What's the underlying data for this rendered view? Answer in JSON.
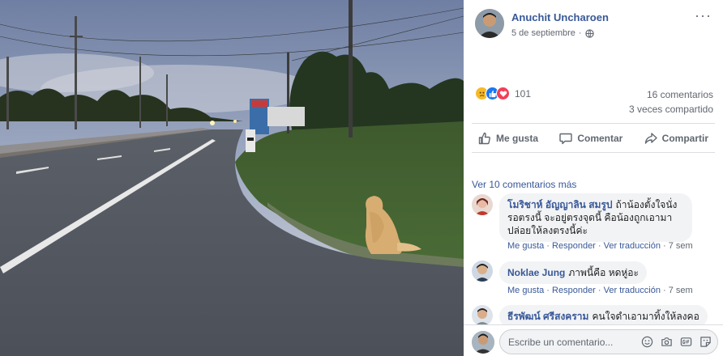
{
  "post": {
    "author": "Anuchit Uncharoen",
    "date": "5 de septiembre",
    "privacy_icon": "globe-icon",
    "more_icon": "more-options-icon",
    "more_label": "···"
  },
  "stats": {
    "reaction_icons": [
      "sad-reaction-icon",
      "like-reaction-icon",
      "love-reaction-icon"
    ],
    "reaction_count": "101",
    "comments": "16 comentarios",
    "shares": "3 veces compartido"
  },
  "actions": {
    "like": "Me gusta",
    "comment": "Comentar",
    "share": "Compartir"
  },
  "comments": {
    "more_link": "Ver 10 comentarios más",
    "items": [
      {
        "name": "โมริชาห์ อัญญาลิน สมรูป",
        "text": "ถ้าน้องตั้งใจนั่งรอตรงนี้ จะอยู่ตรงจุดนี้ คือน้องถูกเอามาปล่อยให้ลงตรงนี้ค่ะ",
        "like": "Me gusta",
        "reply": "Responder",
        "translate": "Ver traducción",
        "time": "7 sem"
      },
      {
        "name": "Noklae Jung",
        "text": "ภาพนี้คือ หดหู่อะ",
        "like": "Me gusta",
        "reply": "Responder",
        "translate": "Ver traducción",
        "time": "7 sem"
      },
      {
        "name": "ธีรพัฒน์ ศรีสงคราม",
        "text": "คนใจดำเอามาทิ้งให้ลงคอ",
        "like": "",
        "reply": "",
        "translate": "",
        "time": ""
      }
    ]
  },
  "composer": {
    "placeholder": "Escribe un comentario...",
    "icons": [
      "emoji-icon",
      "camera-icon",
      "gif-icon",
      "sticker-icon"
    ]
  },
  "colors": {
    "link": "#385898",
    "secondary_text": "#606770",
    "bubble": "#f2f3f5",
    "divider": "#dadde1"
  }
}
